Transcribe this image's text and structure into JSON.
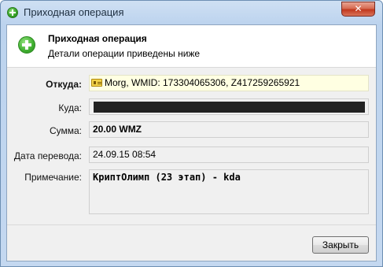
{
  "window": {
    "title": "Приходная операция",
    "close_glyph": "✕"
  },
  "header": {
    "icon": "plus-circle-icon",
    "title": "Приходная операция",
    "subtitle": "Детали операции приведены ниже"
  },
  "fields": {
    "from": {
      "label": "Откуда:",
      "value": "Morg, WMID: 173304065306, Z417259265921",
      "icon": "wm-passport-icon"
    },
    "to": {
      "label": "Куда:",
      "value": ""
    },
    "amount": {
      "label": "Сумма:",
      "value": "20.00 WMZ"
    },
    "date": {
      "label": "Дата перевода:",
      "value": "24.09.15 08:54"
    },
    "note": {
      "label": "Примечание:",
      "value": "КриптОлимп (23 этап) - kda"
    }
  },
  "buttons": {
    "close_label": "Закрыть"
  },
  "colors": {
    "success_icon": "#44b234",
    "from_field_bg": "#ffffe2",
    "redaction": "#222222"
  }
}
